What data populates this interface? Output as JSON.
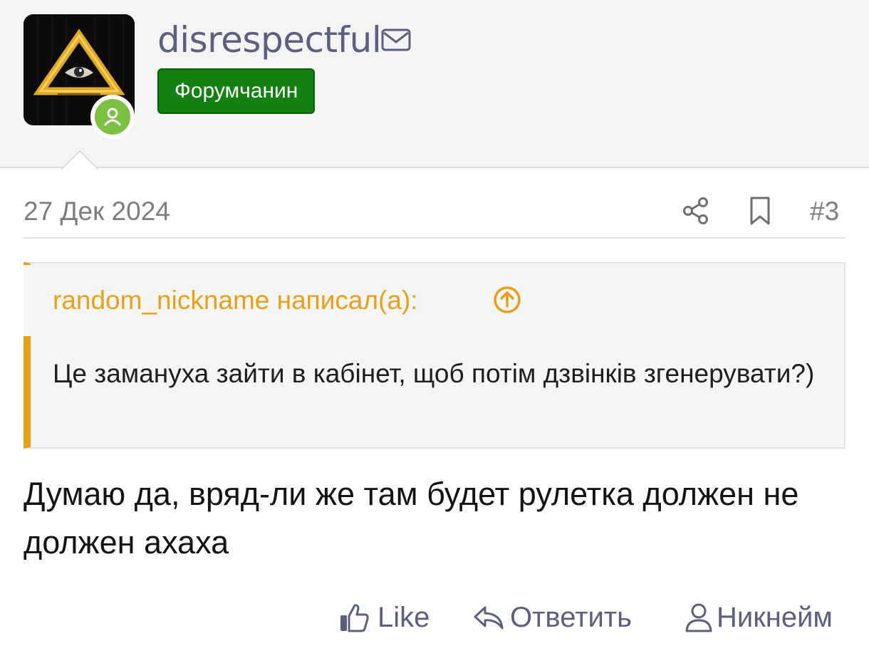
{
  "user": {
    "username": "disrespectful",
    "rank": "Форумчанин",
    "avatar_icon": "illuminati-triangle-eye",
    "status_color": "#7cc042",
    "username_color": "#5c5f80",
    "rank_color": "#128112"
  },
  "post": {
    "date": "27 Дек 2024",
    "number": "#3",
    "body": "Думаю да, вряд-ли же там будет рулетка должен не должен ахаха"
  },
  "quote": {
    "author": "random_nickname написал(а):",
    "text": "Це замануха зайти в кабінет, щоб потім дзвінків згенерувати?)",
    "accent_color": "#e8a019"
  },
  "actions": {
    "like": "Like",
    "reply": "Ответить",
    "nickname": "Никнейм"
  }
}
